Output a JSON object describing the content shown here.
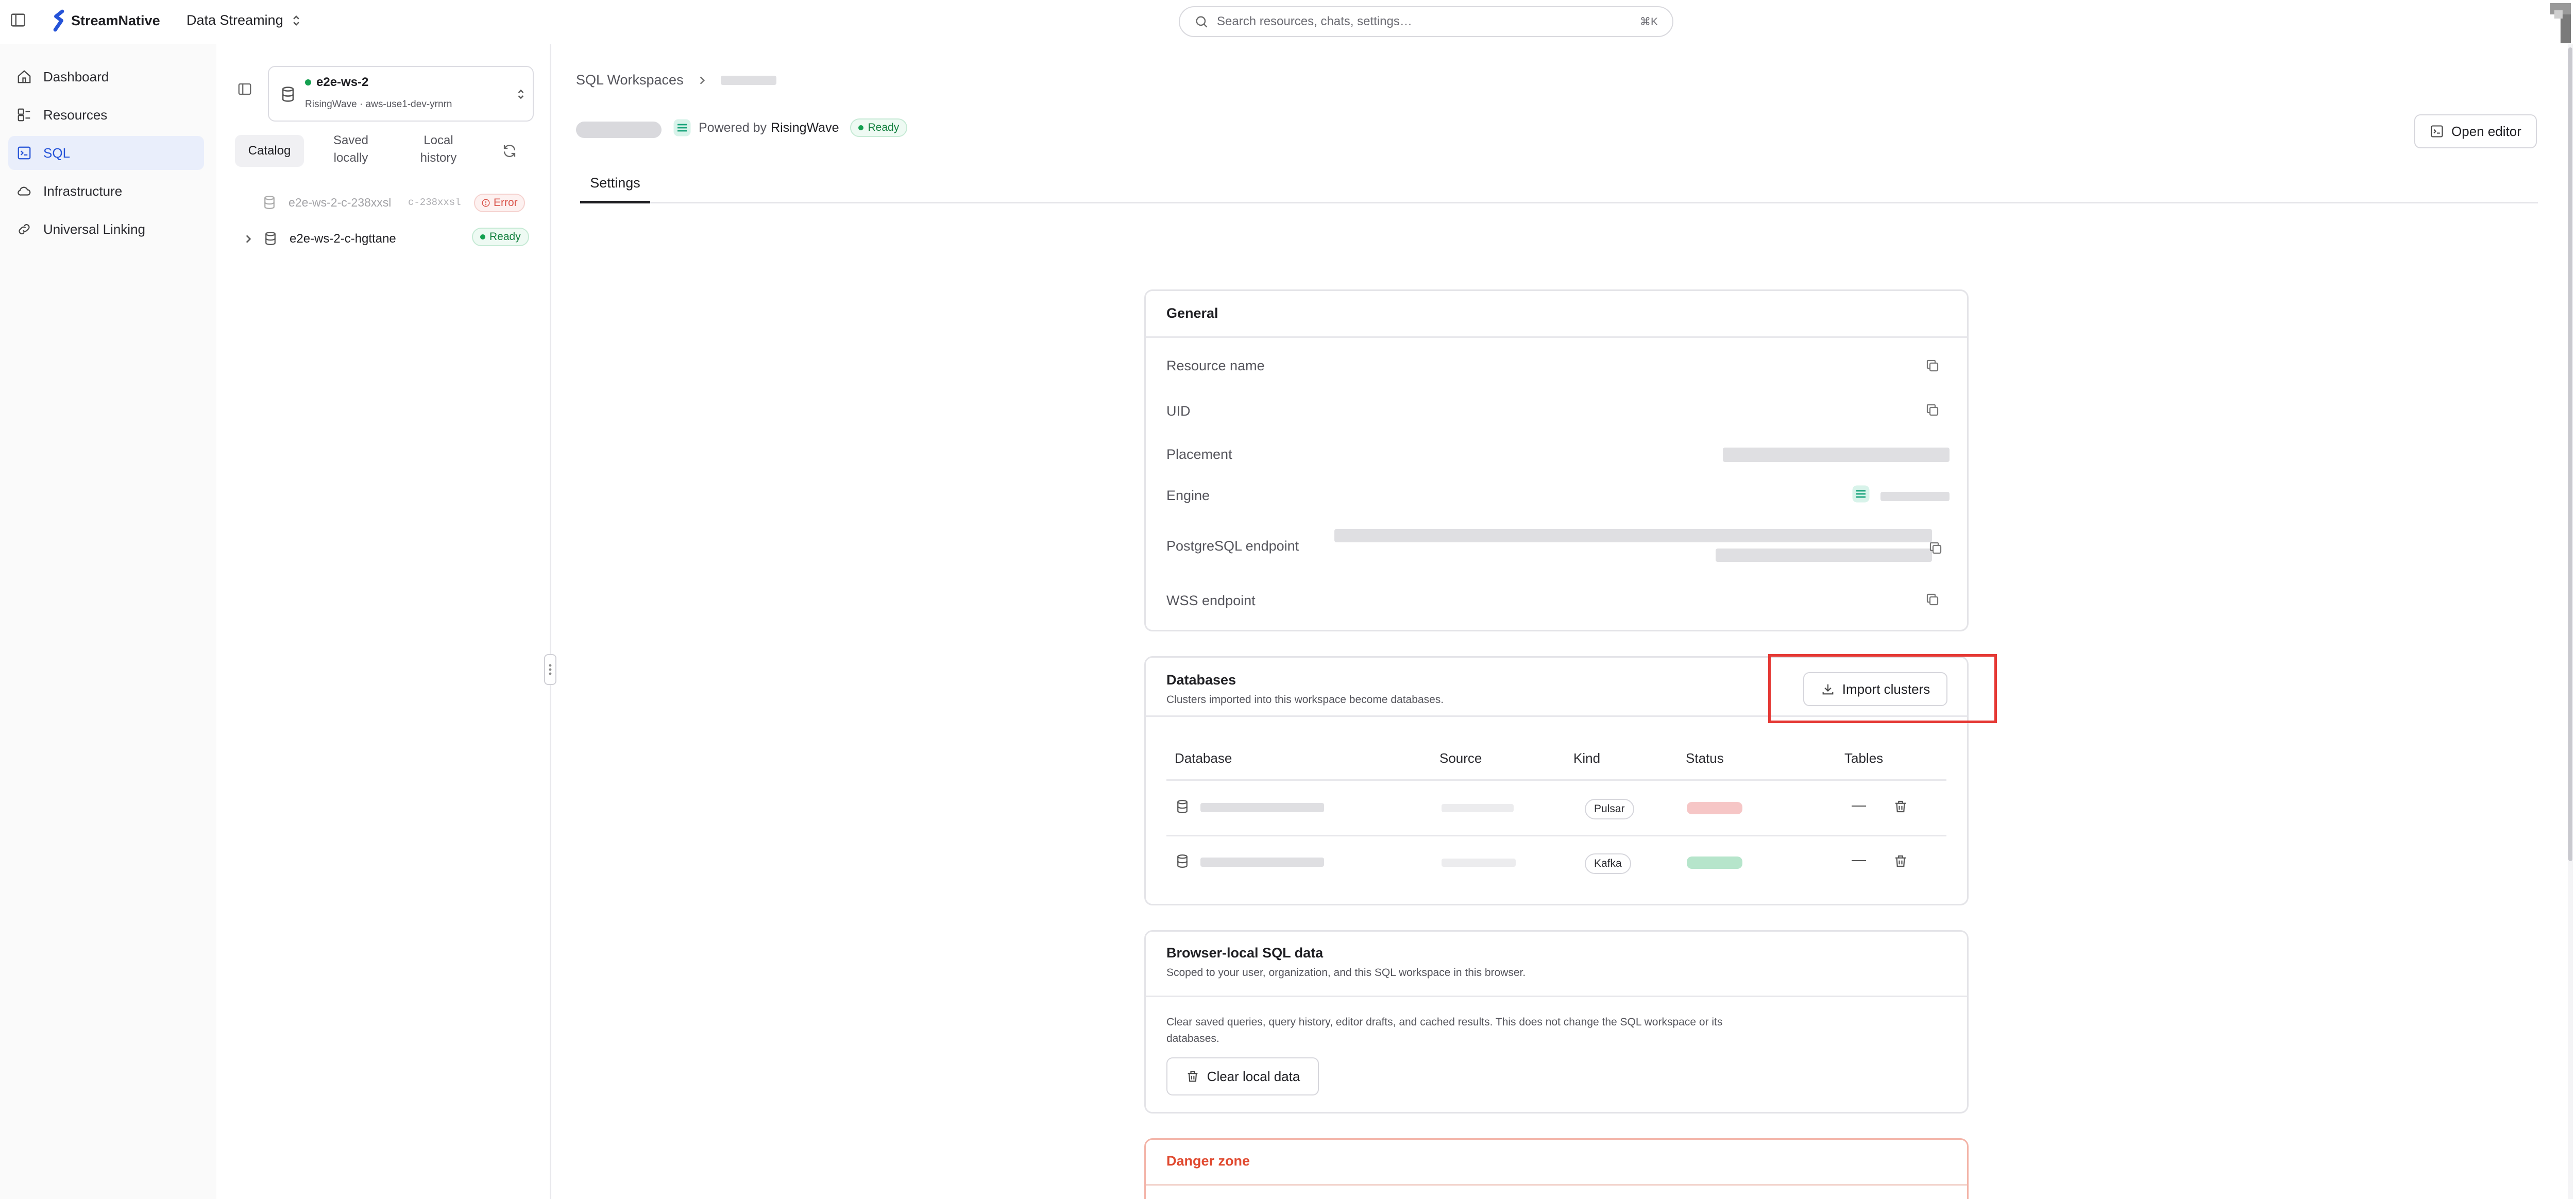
{
  "header": {
    "brand": "StreamNative",
    "context": "Data Streaming",
    "search_placeholder": "Search resources, chats, settings…",
    "search_shortcut": "⌘K"
  },
  "sidebar": {
    "items": [
      {
        "label": "Dashboard",
        "icon": "home-icon"
      },
      {
        "label": "Resources",
        "icon": "resources-icon"
      },
      {
        "label": "SQL",
        "icon": "sql-icon"
      },
      {
        "label": "Infrastructure",
        "icon": "cloud-icon"
      },
      {
        "label": "Universal Linking",
        "icon": "link-icon"
      }
    ],
    "active": "SQL"
  },
  "catalog": {
    "workspace_name": "e2e-ws-2",
    "workspace_sub": "RisingWave · aws-use1-dev-yrnrn",
    "tabs": [
      "Catalog",
      "Saved locally",
      "Local history"
    ],
    "tab_saved_line1": "Saved",
    "tab_saved_line2": "locally",
    "tab_history_line1": "Local",
    "tab_history_line2": "history",
    "entries": [
      {
        "name": "e2e-ws-2-c-238xxsl",
        "id": "c-238xxsl",
        "status": "Error"
      },
      {
        "name": "e2e-ws-2-c-hgttane",
        "status": "Ready"
      }
    ]
  },
  "main": {
    "breadcrumb_root": "SQL Workspaces",
    "powered_by_prefix": "Powered by",
    "powered_by_name": "RisingWave",
    "status": "Ready",
    "open_editor": "Open editor",
    "tab_settings": "Settings",
    "general": {
      "title": "General",
      "fields": [
        "Resource name",
        "UID",
        "Placement",
        "Engine",
        "PostgreSQL endpoint",
        "WSS endpoint"
      ]
    },
    "databases": {
      "title": "Databases",
      "subtitle": "Clusters imported into this workspace become databases.",
      "import_button": "Import clusters",
      "columns": [
        "Database",
        "Source",
        "Kind",
        "Status",
        "Tables"
      ],
      "rows": [
        {
          "kind": "Pulsar",
          "tables": "—",
          "status_color": "#e86b6b"
        },
        {
          "kind": "Kafka",
          "tables": "—",
          "status_color": "#5cc48a"
        }
      ]
    },
    "browser_local": {
      "title": "Browser-local SQL data",
      "subtitle": "Scoped to your user, organization, and this SQL workspace in this browser.",
      "description_line1": "Clear saved queries, query history, editor drafts, and cached results. This does not change the SQL workspace or its",
      "description_line2": "databases.",
      "clear_button": "Clear local data"
    },
    "danger_zone": {
      "title": "Danger zone"
    }
  },
  "colors": {
    "accent": "#2553d8",
    "ready": "#14a050",
    "error": "#d9534a",
    "danger": "#e0492f",
    "highlight": "#e53935"
  }
}
